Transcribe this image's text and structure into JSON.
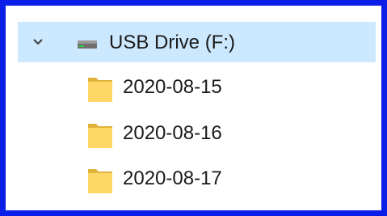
{
  "tree": {
    "drive": {
      "label": "USB Drive (F:)",
      "icon": "usb-drive-icon",
      "expanded": true,
      "selected": true,
      "highlight_color": "#cce8ff"
    },
    "folders": [
      {
        "label": "2020-08-15",
        "icon": "folder-icon"
      },
      {
        "label": "2020-08-16",
        "icon": "folder-icon"
      },
      {
        "label": "2020-08-17",
        "icon": "folder-icon"
      }
    ]
  },
  "colors": {
    "frame_border": "#0a1ee8",
    "folder_fill": "#ffd766",
    "folder_edge": "#e0b43b"
  }
}
